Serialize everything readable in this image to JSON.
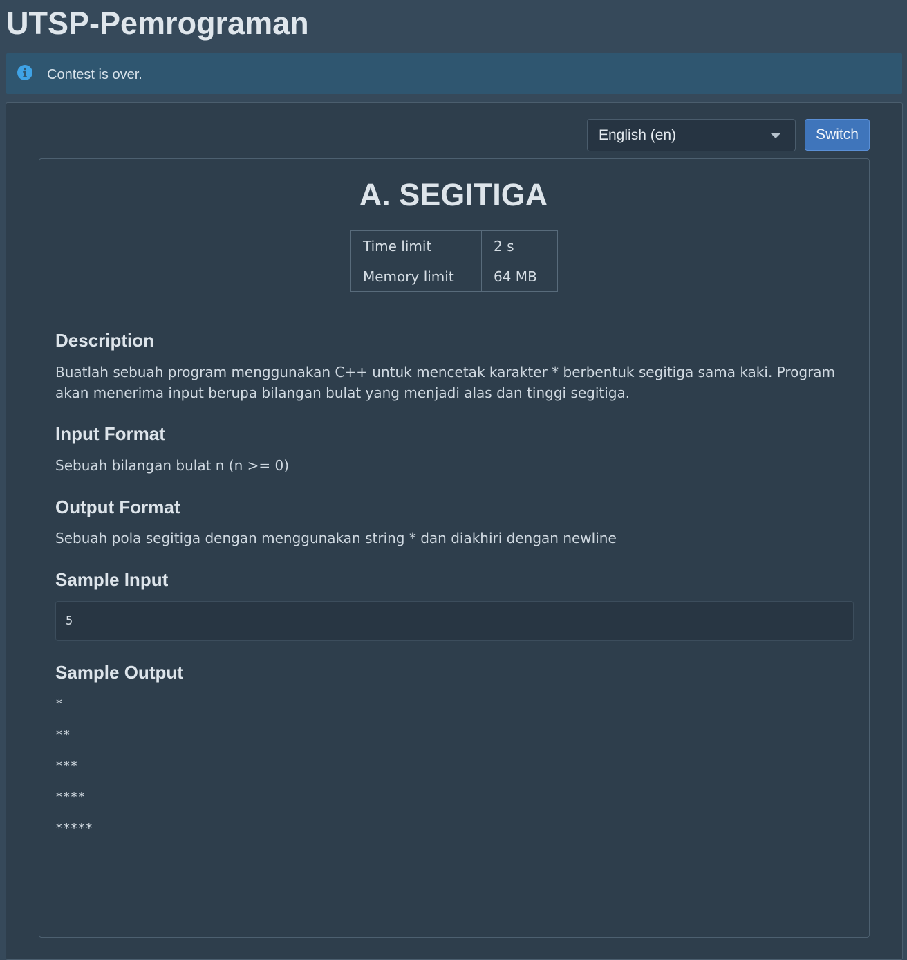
{
  "header": {
    "title": "UTSP-Pemrograman"
  },
  "alert": {
    "icon": "info-icon",
    "message": "Contest is over."
  },
  "language": {
    "selected": "English (en)",
    "switch_label": "Switch"
  },
  "problem": {
    "title": "A. SEGITIGA",
    "limits": [
      {
        "label": "Time limit",
        "value": "2 s"
      },
      {
        "label": "Memory limit",
        "value": "64 MB"
      }
    ],
    "description": {
      "heading": "Description",
      "text": "Buatlah sebuah program menggunakan C++ untuk mencetak karakter * berbentuk segitiga sama kaki. Program akan menerima input berupa bilangan bulat yang menjadi alas dan tinggi segitiga."
    },
    "input_format": {
      "heading": "Input Format",
      "text": "Sebuah bilangan bulat n (n >= 0)"
    },
    "output_format": {
      "heading": "Output Format",
      "text": "Sebuah pola segitiga dengan menggunakan string * dan diakhiri dengan newline"
    },
    "sample_input": {
      "heading": "Sample Input",
      "value": "5"
    },
    "sample_output": {
      "heading": "Sample Output",
      "lines": [
        "*",
        "**",
        "***",
        "****",
        "*****"
      ]
    }
  },
  "colors": {
    "background": "#36495a",
    "alert_background": "#2f5670",
    "info_icon": "#3fa3e6",
    "switch_button": "#3f75bb",
    "panel": "#2e3e4c"
  }
}
